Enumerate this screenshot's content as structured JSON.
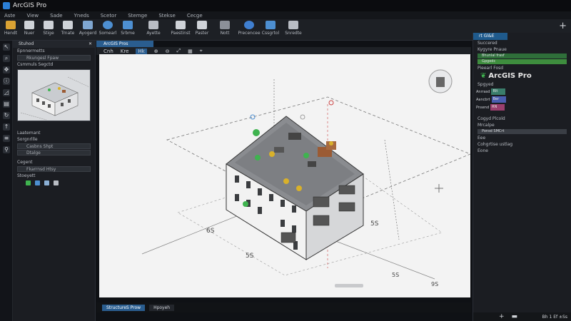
{
  "app": {
    "title": "ArcGIS Pro"
  },
  "menu": {
    "items": [
      "Aste",
      "View",
      "Sade",
      "Yneds",
      "Scetor",
      "Stemge",
      "Stekse",
      "Cecge"
    ]
  },
  "ribbon": {
    "buttons": [
      {
        "label": "Hendt",
        "icon": "paste-icon",
        "color": "#d9a233"
      },
      {
        "label": "Nuer",
        "icon": "new-icon",
        "color": "#cfd3d8"
      },
      {
        "label": "Stige",
        "icon": "save-icon",
        "color": "#cfd3d8"
      },
      {
        "label": "Trnate",
        "icon": "template-icon",
        "color": "#cfd3d8"
      },
      {
        "label": "Ayogerd",
        "icon": "layers-icon",
        "color": "#7fa7d1"
      },
      {
        "label": "Somearl",
        "icon": "gear-icon",
        "color": "#4d8fd1"
      },
      {
        "label": "Srbme",
        "icon": "settings-icon",
        "color": "#4d8fd1"
      },
      {
        "label": "Ayette",
        "icon": "measure-icon",
        "color": "#b9bdc4"
      },
      {
        "label": "Paestinst",
        "icon": "import-icon",
        "color": "#cfd3d8"
      },
      {
        "label": "Paster",
        "icon": "export-icon",
        "color": "#cfd3d8"
      },
      {
        "label": "Nott",
        "icon": "stack-icon",
        "color": "#8b9099"
      },
      {
        "label": "Precencee",
        "icon": "presence-icon",
        "color": "#3f7fd0"
      },
      {
        "label": "Cssgrtol",
        "icon": "pen-icon",
        "color": "#4d8fd1"
      },
      {
        "label": "Snredte",
        "icon": "share-icon",
        "color": "#b9bdc4"
      }
    ],
    "right_glyph": "+"
  },
  "left_panel": {
    "header": "Stuhod",
    "rows": [
      {
        "label": "Epnnermetts",
        "kind": "row"
      },
      {
        "label": "Rkungesl Fpaw",
        "kind": "input"
      },
      {
        "label": "Csmmuls Segctd",
        "kind": "row"
      },
      {
        "label": "Laatemant",
        "kind": "row"
      },
      {
        "label": "Sorgnrllle",
        "kind": "row"
      },
      {
        "label": "Casbns Shpt",
        "kind": "input"
      },
      {
        "label": "Dtalge",
        "kind": "input"
      },
      {
        "label": "Cegent",
        "kind": "row"
      },
      {
        "label": "Fkarrnsd Htsy",
        "kind": "input"
      },
      {
        "label": "Stoeyett",
        "kind": "row"
      }
    ]
  },
  "map": {
    "tab": "ArcGIS Pros",
    "toolbar": [
      "Cnh",
      "Kre",
      "Hk"
    ],
    "dimension_labels": [
      "6S",
      "5S",
      "5S",
      "5S",
      "9S"
    ]
  },
  "bottom_tabs": [
    "StructureS Prow",
    "Hpoyeh"
  ],
  "right_panel": {
    "tab": "rt Gl&E",
    "rows": [
      {
        "label": "Succered",
        "kind": "row"
      },
      {
        "label": "Kygyre Pnaue",
        "kind": "row"
      },
      {
        "label": "Bhunlal frasf",
        "kind": "bar",
        "color": "#2f6f3a"
      },
      {
        "label": "Gpgedc",
        "kind": "bar",
        "color": "#3e8d3e"
      },
      {
        "label": "Pieearl Fosd",
        "kind": "row"
      }
    ],
    "brand": "ArcGIS Pro",
    "symbol_section": "Spgyed",
    "swatches": [
      {
        "label": "Anrrasd",
        "value": "Rlt",
        "color": "#3a7d6b"
      },
      {
        "label": "Aancbrt",
        "value": "Ber",
        "color": "#4a5db0"
      },
      {
        "label": "Pnsend",
        "value": "RN",
        "color": "#9a3f6e"
      }
    ],
    "rows2": [
      {
        "label": "Cogyd Plcold",
        "kind": "row"
      },
      {
        "label": "Mrcalpe",
        "kind": "input"
      },
      {
        "label": "Ponsd SMCrt",
        "kind": "bar",
        "color": "#3a3e45"
      },
      {
        "label": "Eee",
        "kind": "input"
      },
      {
        "label": "Cohgrtise ustlag",
        "kind": "row"
      },
      {
        "label": "Eone",
        "kind": "row"
      }
    ],
    "footer_glyphs": [
      "+",
      "▬"
    ],
    "footer_text": "Bh 1 Ef ±Ss"
  },
  "colors": {
    "accent": "#2a5d8f",
    "green": "#3fb34f",
    "gold": "#d9b12a",
    "brown": "#9b5b34"
  }
}
